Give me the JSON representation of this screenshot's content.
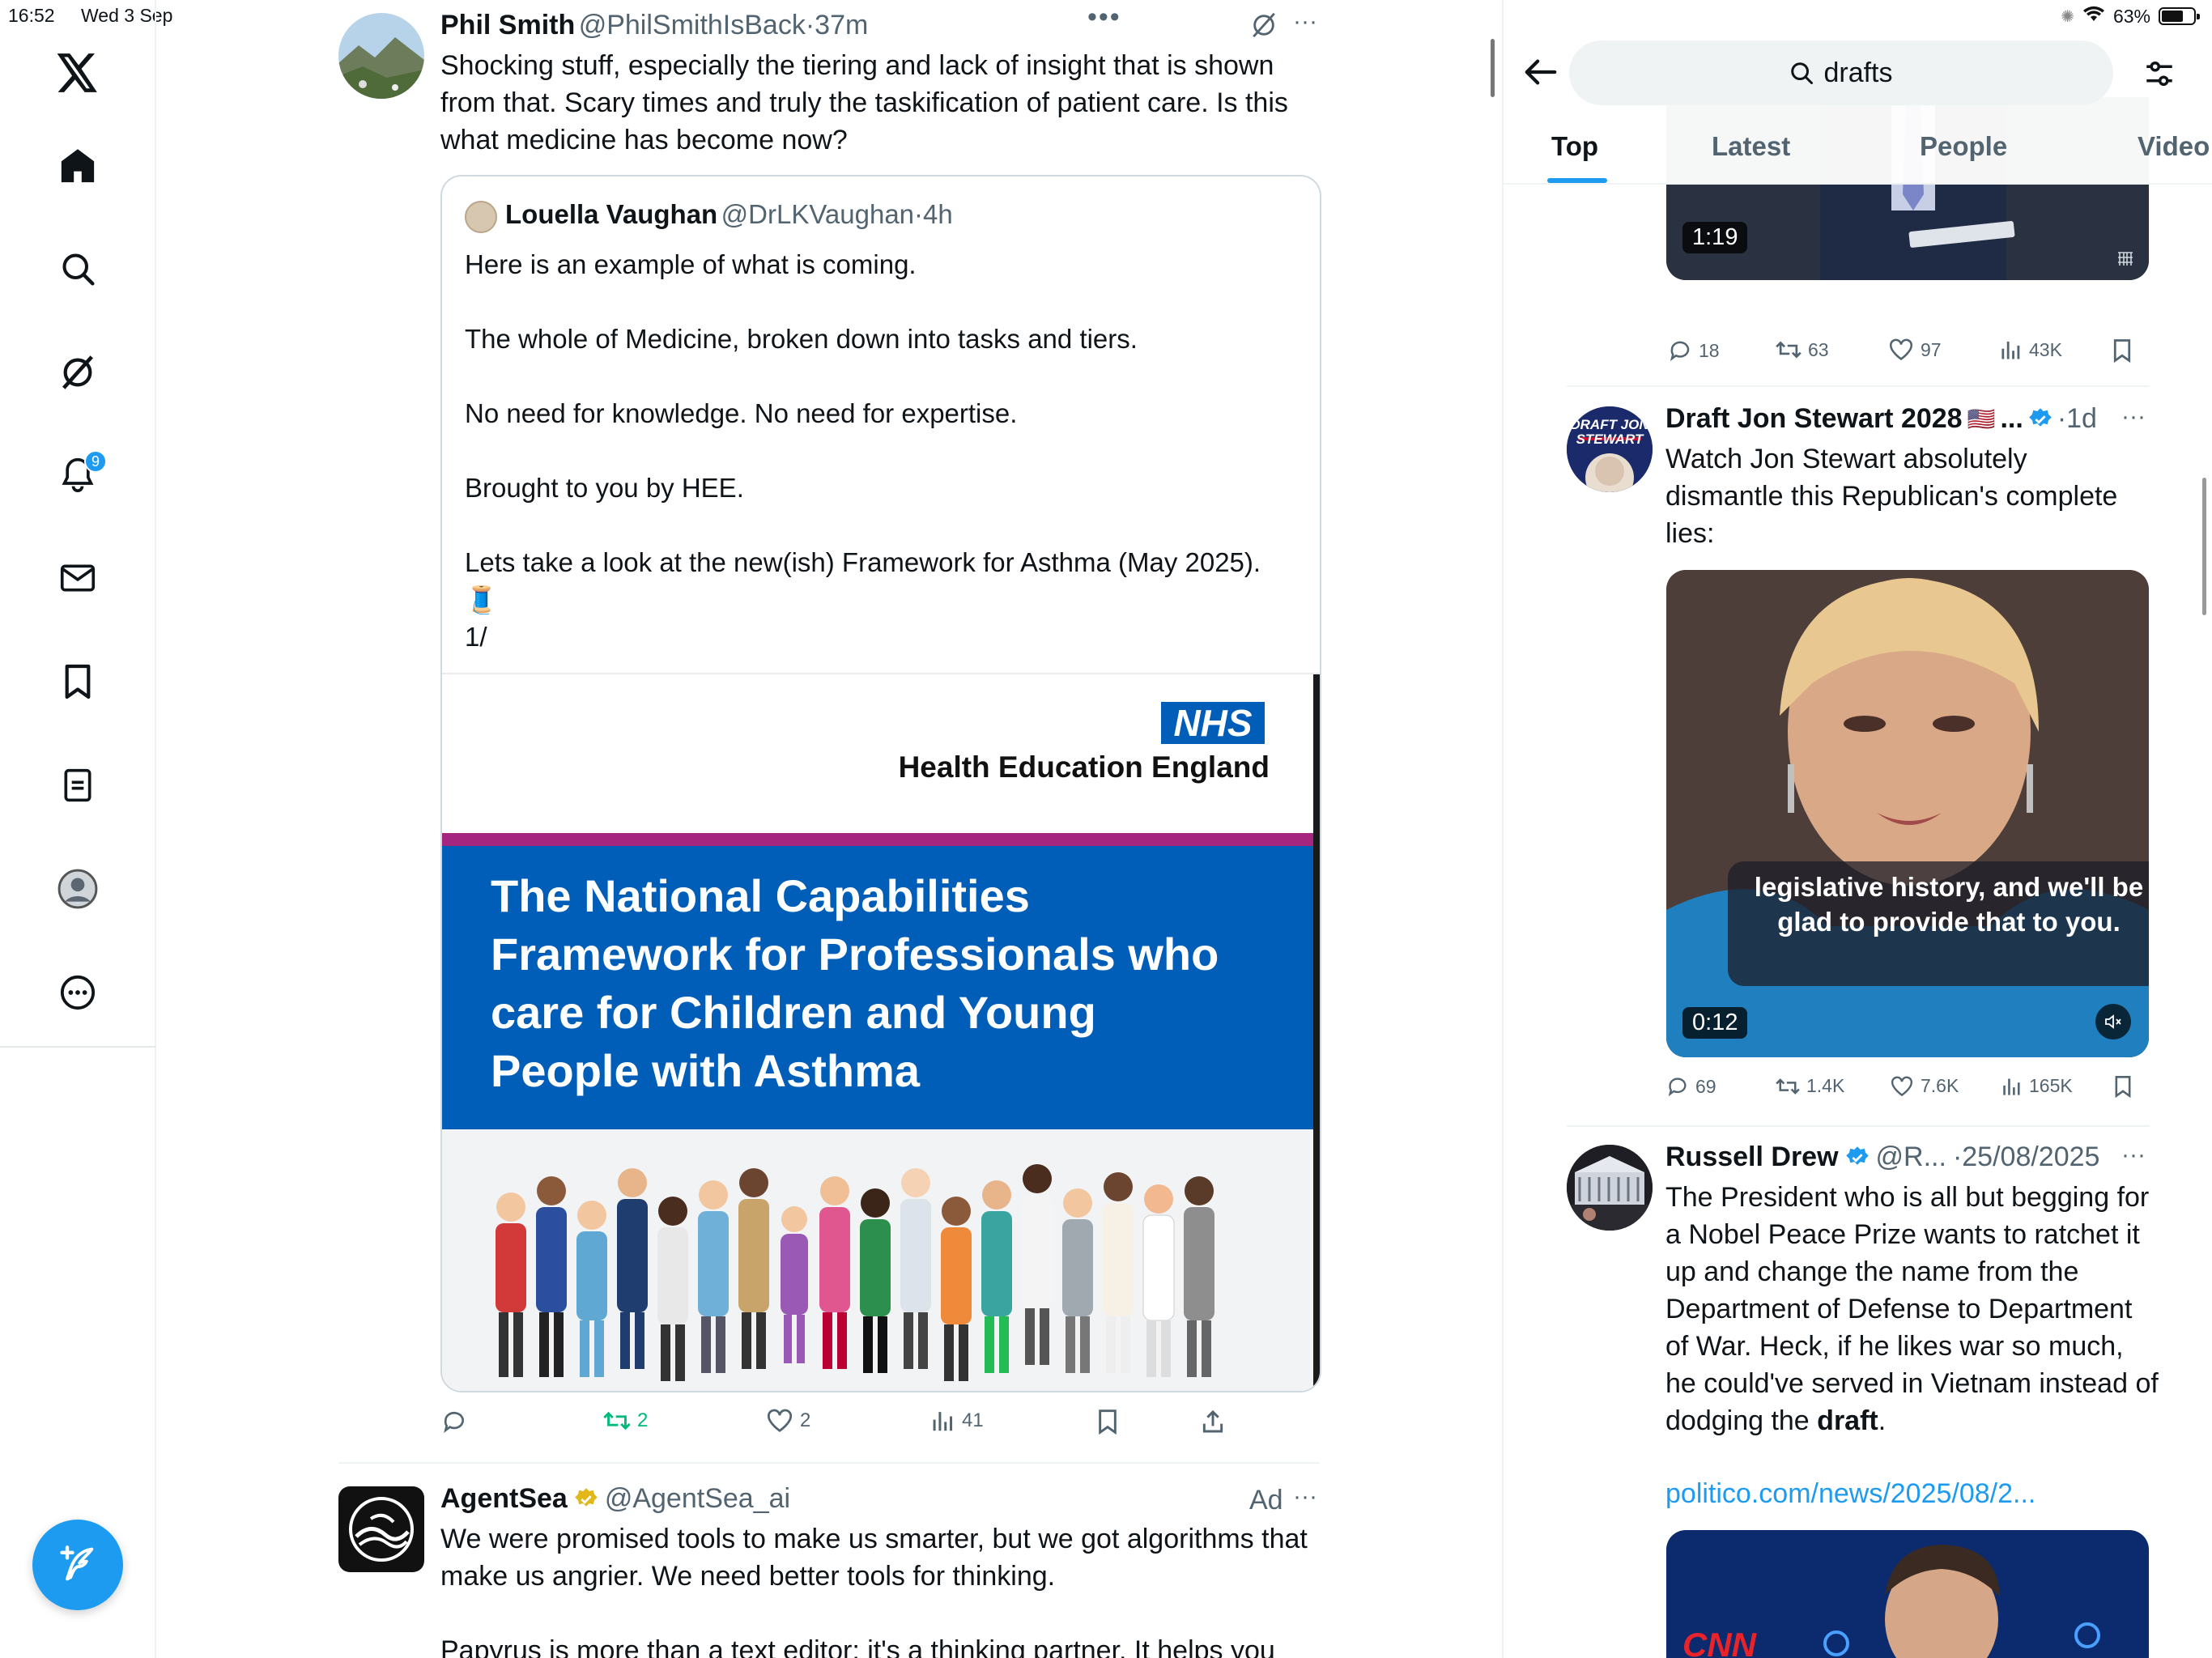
{
  "status_bar": {
    "time": "16:52",
    "date": "Wed 3 Sep",
    "battery": "63%"
  },
  "nav": {
    "items": [
      "home",
      "explore",
      "grok",
      "notifications",
      "messages",
      "bookmarks",
      "lists",
      "profile",
      "more"
    ],
    "notification_count": "9",
    "compose_label": "Post"
  },
  "feed": {
    "tweet1": {
      "name": "Phil Smith",
      "handle": "@PhilSmithIsBack",
      "time": "·37m",
      "text": "Shocking stuff, especially the tiering and lack of insight that is shown from that.  Scary times and truly the taskification of patient care. Is this what medicine has become now?",
      "quote": {
        "name": "Louella Vaughan",
        "handle": "@DrLKVaughan",
        "time": "·4h",
        "lines": [
          "Here is an example of what is coming.",
          "The whole of Medicine, broken down into tasks and tiers.",
          "No need for knowledge. No need for expertise.",
          "Brought to you by HEE.",
          "Lets take a look at the new(ish) Framework for Asthma (May 2025).",
          "🧵",
          "1/"
        ],
        "image": {
          "nhs_logo": "NHS",
          "org": "Health Education England",
          "title": "The National Capabilities Framework for Professionals who care for Children and Young People with Asthma"
        }
      },
      "stats": {
        "replies": "",
        "reposts": "2",
        "likes": "2",
        "views": "41"
      }
    },
    "tweet2": {
      "name": "AgentSea",
      "handle": "@AgentSea_ai",
      "ad_label": "Ad",
      "text": "We were promised tools to make us smarter, but we got algorithms that make us angrier. We need better tools for thinking.",
      "text2": "Papyrus is more than a text editor; it's a thinking partner. It helps you"
    }
  },
  "search": {
    "query": "drafts",
    "tabs": [
      "Top",
      "Latest",
      "People",
      "Video"
    ],
    "active_tab": "Top"
  },
  "results": {
    "r0": {
      "duration": "1:19",
      "replies": "18",
      "reposts": "63",
      "likes": "97",
      "views": "43K"
    },
    "r1": {
      "name": "Draft Jon Stewart 2028",
      "flag": "🇺🇸",
      "ellipsis": "...",
      "time": "·1d",
      "text": "Watch Jon Stewart absolutely dismantle this Republican's complete lies:",
      "avatar_text": "DRAFT JON STEWART",
      "caption": "legislative history, and we'll be glad to provide that to you.",
      "duration": "0:12",
      "replies": "69",
      "reposts": "1.4K",
      "likes": "7.6K",
      "views": "165K"
    },
    "r2": {
      "name": "Russell Drew",
      "handle": "@R...",
      "time": "·25/08/2025",
      "text_before": "The President who is all but begging for a Nobel Peace Prize wants to ratchet it up and change the name from the Department of Defense to Department of War. Heck, if he likes war so much, he could've served in Vietnam instead of dodging the ",
      "text_bold": "draft",
      "text_after": ".",
      "link": "politico.com/news/2025/08/2...",
      "video_logo": "CNN"
    }
  },
  "colors": {
    "accent": "#1d9bf0",
    "nhs_blue": "#005eb8",
    "repost_green": "#00ba7c",
    "magenta_bar": "#a4267f"
  }
}
